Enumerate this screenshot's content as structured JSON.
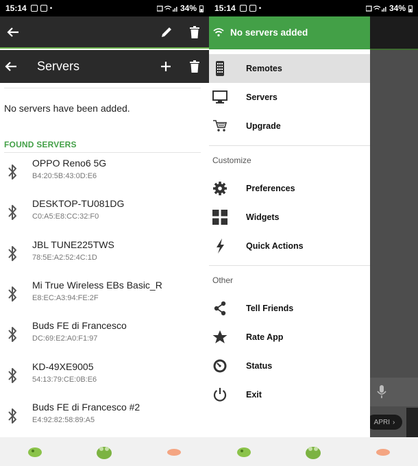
{
  "status_bar": {
    "time": "15:14",
    "battery": "34%"
  },
  "left": {
    "title": "Servers",
    "empty_message": "No servers have been added.",
    "found_header": "FOUND SERVERS",
    "devices": [
      {
        "name": "OPPO Reno6 5G",
        "mac": "B4:20:5B:43:0D:E6"
      },
      {
        "name": "DESKTOP-TU081DG",
        "mac": "C0:A5:E8:CC:32:F0"
      },
      {
        "name": "JBL TUNE225TWS",
        "mac": "78:5E:A2:52:4C:1D"
      },
      {
        "name": "Mi True Wireless EBs Basic_R",
        "mac": "E8:EC:A3:94:FE:2F"
      },
      {
        "name": "Buds FE di Francesco",
        "mac": "DC:69:E2:A0:F1:97"
      },
      {
        "name": "KD-49XE9005",
        "mac": "54:13:79:CE:0B:E6"
      },
      {
        "name": "Buds FE di Francesco #2",
        "mac": "E4:92:82:58:89:A5"
      }
    ]
  },
  "drawer": {
    "header_title": "No servers added",
    "items_main": [
      {
        "label": "Remotes",
        "icon": "remote-icon"
      },
      {
        "label": "Servers",
        "icon": "monitor-icon"
      },
      {
        "label": "Upgrade",
        "icon": "cart-icon"
      }
    ],
    "section_customize": "Customize",
    "items_customize": [
      {
        "label": "Preferences",
        "icon": "gear-icon"
      },
      {
        "label": "Widgets",
        "icon": "widgets-icon"
      },
      {
        "label": "Quick Actions",
        "icon": "lightning-icon"
      }
    ],
    "section_other": "Other",
    "items_other": [
      {
        "label": "Tell Friends",
        "icon": "share-icon"
      },
      {
        "label": "Rate App",
        "icon": "star-icon"
      },
      {
        "label": "Status",
        "icon": "gauge-icon"
      },
      {
        "label": "Exit",
        "icon": "power-icon"
      }
    ]
  },
  "background": {
    "ad_button": "APRI"
  },
  "colors": {
    "accent_green": "#43a047",
    "appbar_dark": "#2a2a2a"
  }
}
